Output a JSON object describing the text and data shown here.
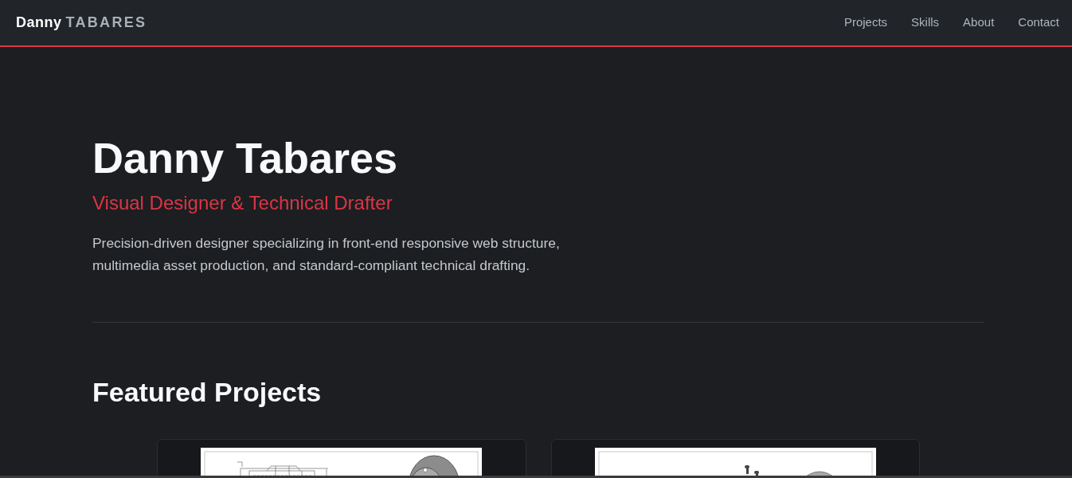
{
  "header": {
    "brand": {
      "first": "Danny",
      "last": "TABARES"
    },
    "nav": [
      {
        "label": "Projects"
      },
      {
        "label": "Skills"
      },
      {
        "label": "About"
      },
      {
        "label": "Contact"
      }
    ]
  },
  "hero": {
    "title": "Danny Tabares",
    "subtitle": "Visual Designer & Technical Drafter",
    "description": "Precision-driven designer specializing in front-end responsive web structure, multimedia asset production, and standard-compliant technical drafting."
  },
  "projects": {
    "heading": "Featured Projects",
    "cards": [
      {
        "kind": "wheel"
      },
      {
        "kind": "bolts"
      }
    ]
  }
}
